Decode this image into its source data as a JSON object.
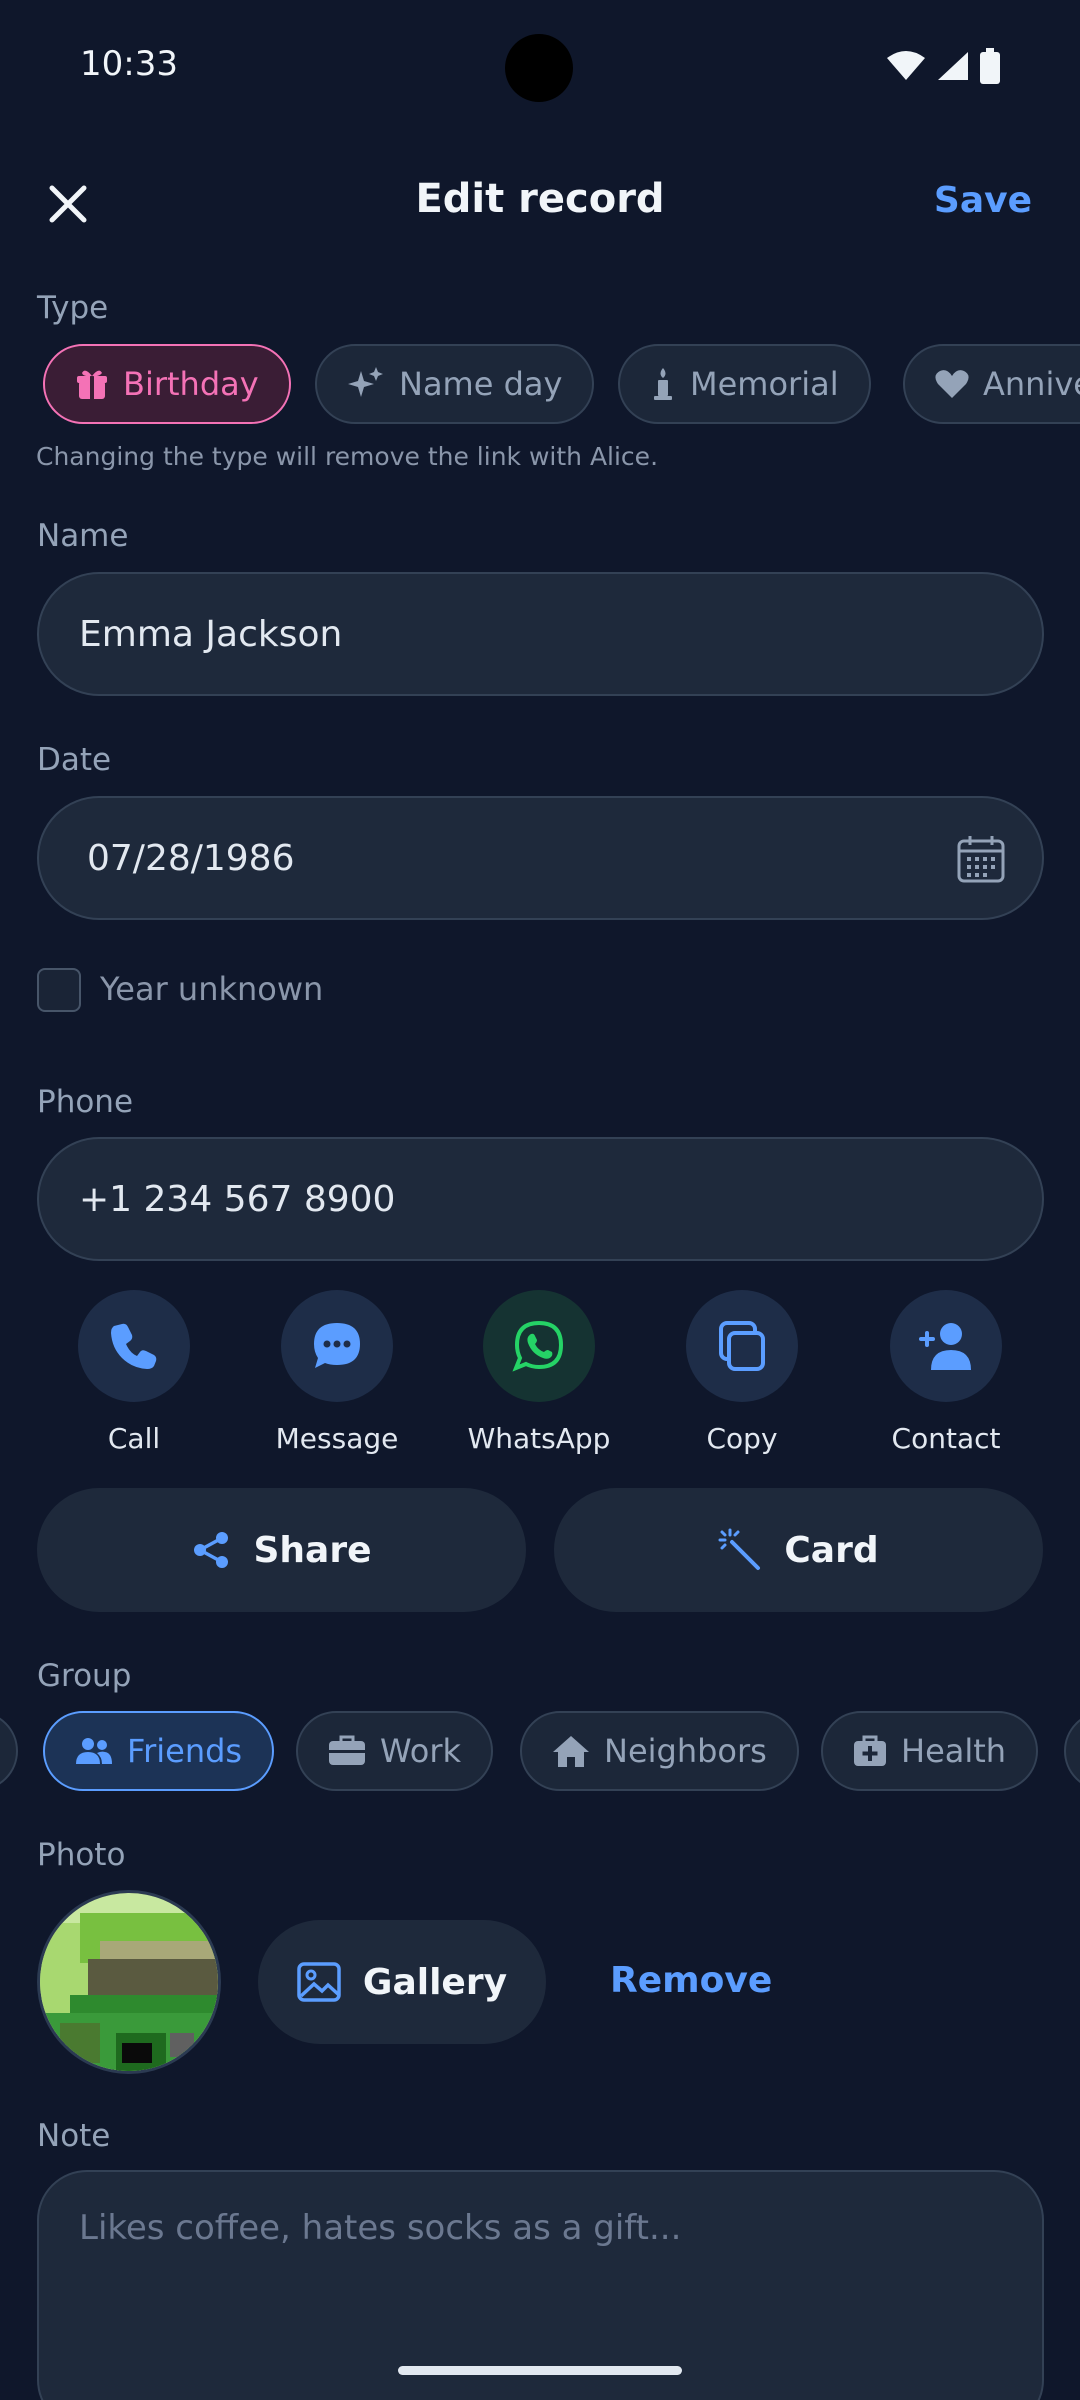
{
  "status_bar": {
    "time": "10:33"
  },
  "header": {
    "title": "Edit record",
    "save_label": "Save"
  },
  "type_section": {
    "label": "Type",
    "options": [
      {
        "label": "Birthday",
        "icon": "gift-icon",
        "selected": true
      },
      {
        "label": "Name day",
        "icon": "sparkles-icon",
        "selected": false
      },
      {
        "label": "Memorial",
        "icon": "candle-icon",
        "selected": false
      },
      {
        "label": "Anniversary",
        "icon": "heart-icon",
        "selected": false
      }
    ],
    "hint": "Changing the type will remove the link with Alice."
  },
  "name_section": {
    "label": "Name",
    "value": "Emma Jackson"
  },
  "date_section": {
    "label": "Date",
    "value": "07/28/1986",
    "year_unknown_label": "Year unknown",
    "year_unknown_checked": false
  },
  "phone_section": {
    "label": "Phone",
    "value": "+1 234 567 8900",
    "actions": [
      {
        "label": "Call",
        "icon": "phone-icon"
      },
      {
        "label": "Message",
        "icon": "message-icon"
      },
      {
        "label": "WhatsApp",
        "icon": "whatsapp-icon"
      },
      {
        "label": "Copy",
        "icon": "copy-icon"
      },
      {
        "label": "Contact",
        "icon": "add-contact-icon"
      }
    ]
  },
  "buttons": {
    "share_label": "Share",
    "card_label": "Card"
  },
  "group_section": {
    "label": "Group",
    "options": [
      {
        "label": "Friends",
        "icon": "people-icon",
        "selected": true
      },
      {
        "label": "Work",
        "icon": "briefcase-icon",
        "selected": false
      },
      {
        "label": "Neighbors",
        "icon": "house-icon",
        "selected": false
      },
      {
        "label": "Health",
        "icon": "medkit-icon",
        "selected": false
      }
    ]
  },
  "photo_section": {
    "label": "Photo",
    "gallery_label": "Gallery",
    "remove_label": "Remove"
  },
  "note_section": {
    "label": "Note",
    "placeholder": "Likes coffee, hates socks as a gift..."
  },
  "colors": {
    "background": "#0f172b",
    "accent_blue": "#5b9dff",
    "accent_pink": "#f472b6",
    "whatsapp_green": "#25d366"
  }
}
